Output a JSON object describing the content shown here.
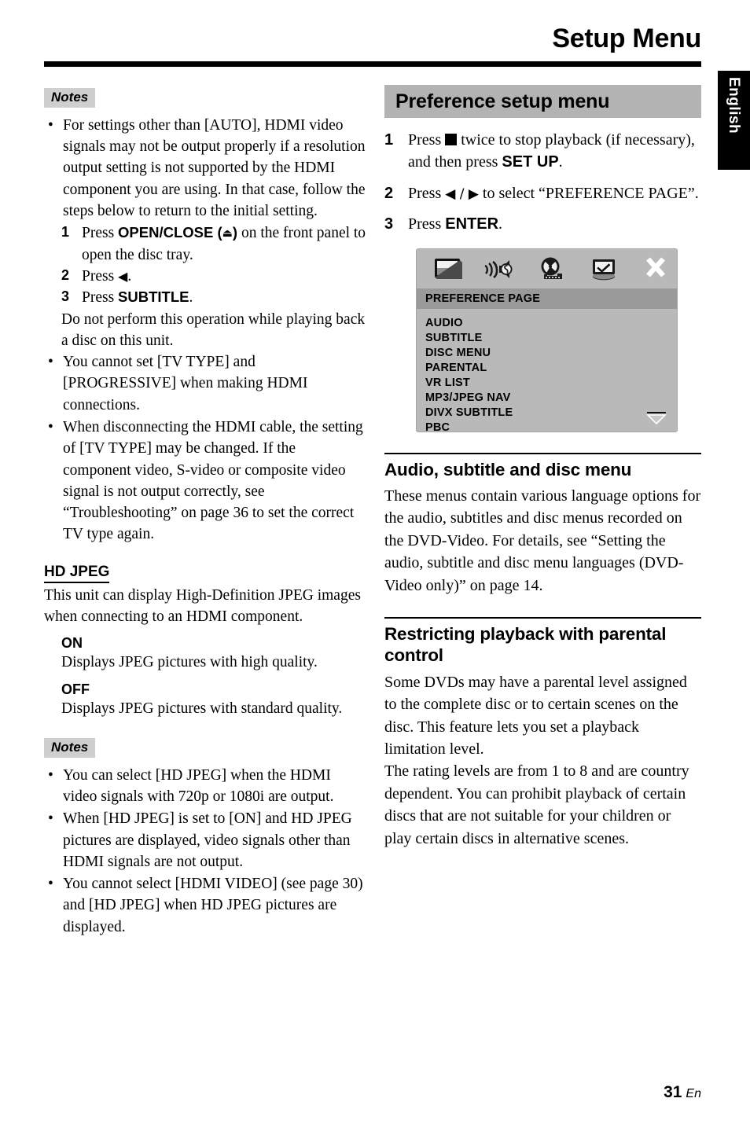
{
  "header": {
    "title": "Setup Menu",
    "language_tab": "English"
  },
  "footer": {
    "page_number": "31",
    "language_code": "En"
  },
  "left_column": {
    "notes_label_1": "Notes",
    "note_1": "For settings other than [AUTO], HDMI video signals may not be output properly if a resolution output setting is not supported by the HDMI component you are using. In that case, follow the steps below to return to the initial setting.",
    "substeps": [
      {
        "num": "1",
        "pre": "Press ",
        "bold": "OPEN/CLOSE (",
        "glyph": "⏏",
        "bold_end": ")",
        "post": " on the front panel to open the disc tray."
      },
      {
        "num": "2",
        "pre": "Press ",
        "bold": "",
        "glyph": "◀",
        "bold_end": "",
        "post": "."
      },
      {
        "num": "3",
        "pre": "Press ",
        "bold": "SUBTITLE",
        "glyph": "",
        "bold_end": "",
        "post": "."
      }
    ],
    "substeps_footnote": "Do not perform this operation while playing back a disc on this unit.",
    "note_2": "You cannot set [TV TYPE] and [PROGRESSIVE] when making HDMI connections.",
    "note_3": "When disconnecting the HDMI cable, the setting of [TV TYPE] may be changed. If the component video, S-video or composite video signal is not output correctly, see “Troubleshooting” on page 36 to set the correct TV type again.",
    "hd_jpeg_heading": "HD JPEG",
    "hd_jpeg_body": "This unit can display High-Definition JPEG images when connecting to an HDMI component.",
    "options": [
      {
        "name": "ON",
        "desc": "Displays JPEG pictures with high quality."
      },
      {
        "name": "OFF",
        "desc": "Displays JPEG pictures with standard quality."
      }
    ],
    "notes_label_2": "Notes",
    "notes_2": [
      "You can select [HD JPEG] when the HDMI video signals with 720p or 1080i are output.",
      "When [HD JPEG] is set to [ON] and HD JPEG pictures are displayed, video signals other than HDMI signals are not output.",
      "You cannot select [HDMI VIDEO] (see page 30) and [HD JPEG] when HD JPEG pictures are displayed."
    ]
  },
  "right_column": {
    "section_title": "Preference setup menu",
    "steps": [
      {
        "num": "1",
        "part_a": "Press ",
        "glyph": "stop-square",
        "part_b": " twice to stop playback (if necessary), and then press ",
        "bold": "SET UP",
        "part_c": "."
      },
      {
        "num": "2",
        "part_a": "Press ",
        "glyph": "left-right-arrows",
        "part_b": " to select “PREFERENCE PAGE”.",
        "bold": "",
        "part_c": ""
      },
      {
        "num": "3",
        "part_a": "Press ",
        "glyph": "",
        "part_b": "",
        "bold": "ENTER",
        "part_c": "."
      }
    ],
    "osd": {
      "icons": [
        "tv-screen-icon",
        "speaker-audio-icon",
        "film-reel-icon",
        "preference-display-icon",
        "close-x-icon"
      ],
      "page_bar": "PREFERENCE PAGE",
      "items": [
        "AUDIO",
        "SUBTITLE",
        "DISC MENU",
        "PARENTAL",
        "VR LIST",
        "MP3/JPEG NAV",
        "DIVX SUBTITLE",
        "PBC"
      ],
      "scroll_indicator": "chevron-down-icon"
    },
    "subsection_1": {
      "title": "Audio, subtitle and disc menu",
      "body": "These menus contain various language options for the audio, subtitles and disc menus recorded on the DVD-Video. For details, see “Setting the audio, subtitle and disc menu languages (DVD-Video only)” on page 14."
    },
    "subsection_2": {
      "title": "Restricting playback with parental control",
      "body_1": "Some DVDs may have a parental level assigned to the complete disc or to certain scenes on the disc. This feature lets you set a playback limitation level.",
      "body_2": "The rating levels are from 1 to 8 and are country dependent. You can prohibit playback of certain discs that are not suitable for your children or play certain discs in alternative scenes."
    }
  },
  "colors": {
    "notes_bg": "#cfcfcf",
    "section_bar_bg": "#b3b3b3",
    "osd_bg": "#b9b9b9",
    "osd_pagebar_bg": "#9a9a9a",
    "tab_bg": "#000000"
  }
}
